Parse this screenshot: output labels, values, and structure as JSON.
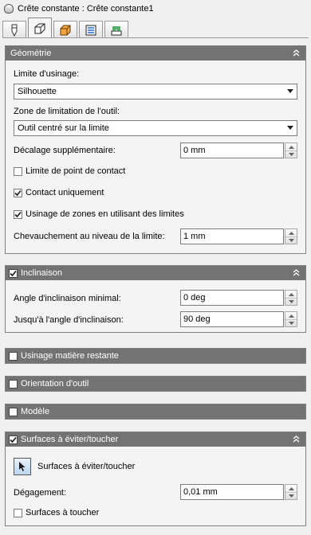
{
  "window": {
    "title": "Crête constante : Crête constante1"
  },
  "tabs": [
    {
      "name": "tool-tab-icon"
    },
    {
      "name": "geometry-tab-icon"
    },
    {
      "name": "block-tab-icon"
    },
    {
      "name": "linking-tab-icon"
    },
    {
      "name": "passes-tab-icon"
    }
  ],
  "geometry": {
    "header": "Géométrie",
    "limit_label": "Limite d'usinage:",
    "limit_value": "Silhouette",
    "zone_label": "Zone de limitation de l'outil:",
    "zone_value": "Outil centré sur la limite",
    "offset_label": "Décalage supplémentaire:",
    "offset_value": "0 mm",
    "contact_limit_label": "Limite de point de contact",
    "contact_limit_checked": false,
    "contact_only_label": "Contact uniquement",
    "contact_only_checked": true,
    "zones_label": "Usinage de zones en utilisant des limites",
    "zones_checked": true,
    "overlap_label": "Chevauchement au niveau de la limite:",
    "overlap_value": "1 mm"
  },
  "inclination": {
    "header": "Inclinaison",
    "checked": true,
    "min_label": "Angle d'inclinaison minimal:",
    "min_value": "0 deg",
    "max_label": "Jusqu'à l'angle d'inclinaison:",
    "max_value": "90 deg"
  },
  "rest": {
    "header": "Usinage matière restante",
    "checked": false
  },
  "orientation": {
    "header": "Orientation d'outil",
    "checked": false
  },
  "model": {
    "header": "Modèle",
    "checked": false
  },
  "avoid": {
    "header": "Surfaces à éviter/toucher",
    "checked": true,
    "select_label": "Surfaces à éviter/toucher",
    "clearance_label": "Dégagement:",
    "clearance_value": "0,01 mm",
    "touch_label": "Surfaces à toucher",
    "touch_checked": false
  }
}
